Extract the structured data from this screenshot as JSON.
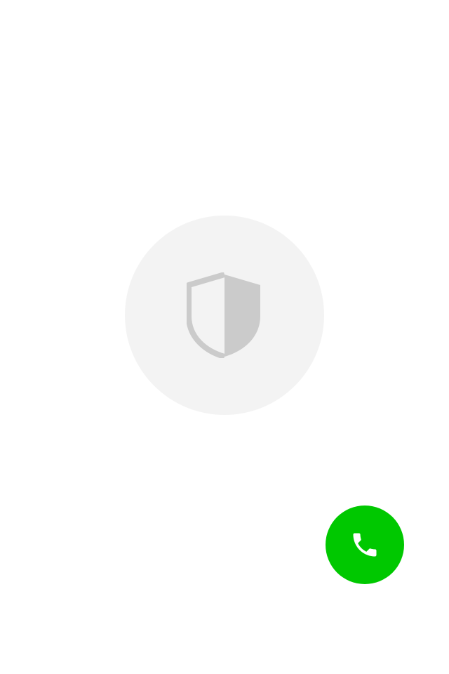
{
  "placeholder": {
    "icon": "shield-icon",
    "circle_color": "#f3f3f3",
    "icon_color": "#cbcbcb"
  },
  "call_button": {
    "icon": "phone-icon",
    "color": "#00c800",
    "icon_color": "#ffffff"
  }
}
